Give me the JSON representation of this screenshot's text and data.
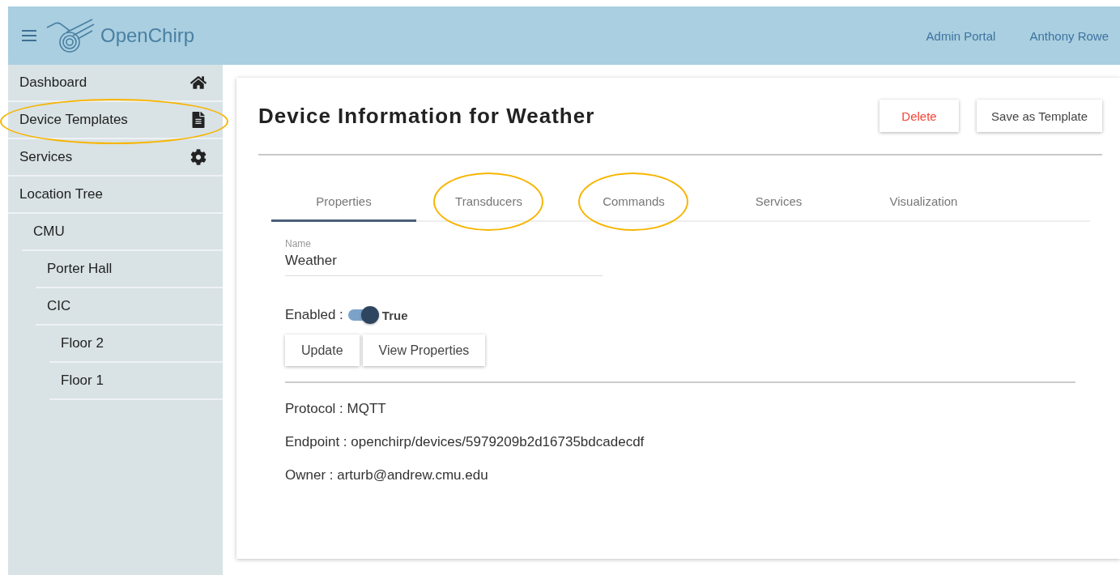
{
  "header": {
    "app_name": "OpenChirp",
    "links": [
      "Admin Portal",
      "Anthony Rowe"
    ]
  },
  "sidebar": {
    "items": [
      {
        "label": "Dashboard",
        "circled": false
      },
      {
        "label": "Device Templates",
        "circled": true
      },
      {
        "label": "Services",
        "circled": false
      }
    ],
    "tree": {
      "label": "Location Tree",
      "children": [
        {
          "label": "CMU",
          "children": [
            {
              "label": "Porter Hall"
            },
            {
              "label": "CIC",
              "children": [
                {
                  "label": "Floor 2"
                },
                {
                  "label": "Floor 1"
                }
              ]
            }
          ]
        }
      ]
    }
  },
  "page": {
    "title": "Device Information for Weather",
    "actions": [
      {
        "label": "Delete",
        "kind": "danger"
      },
      {
        "label": "Save as Template",
        "kind": "plain"
      }
    ],
    "tabs": [
      {
        "label": "Properties",
        "selected": true,
        "circled": false
      },
      {
        "label": "Transducers",
        "selected": false,
        "circled": true
      },
      {
        "label": "Commands",
        "selected": false,
        "circled": true
      },
      {
        "label": "Services",
        "selected": false,
        "circled": false
      },
      {
        "label": "Visualization",
        "selected": false,
        "circled": false
      }
    ],
    "name_field": {
      "label": "Name",
      "value": "Weather"
    },
    "enabled": {
      "label": "Enabled :",
      "on": true,
      "text": "True"
    },
    "buttons": [
      "Update",
      "View Properties"
    ],
    "info": [
      "Protocol : MQTT",
      "Endpoint : openchirp/devices/5979209b2d16735bdcadecdf",
      "Owner : arturb@andrew.cmu.edu"
    ]
  }
}
